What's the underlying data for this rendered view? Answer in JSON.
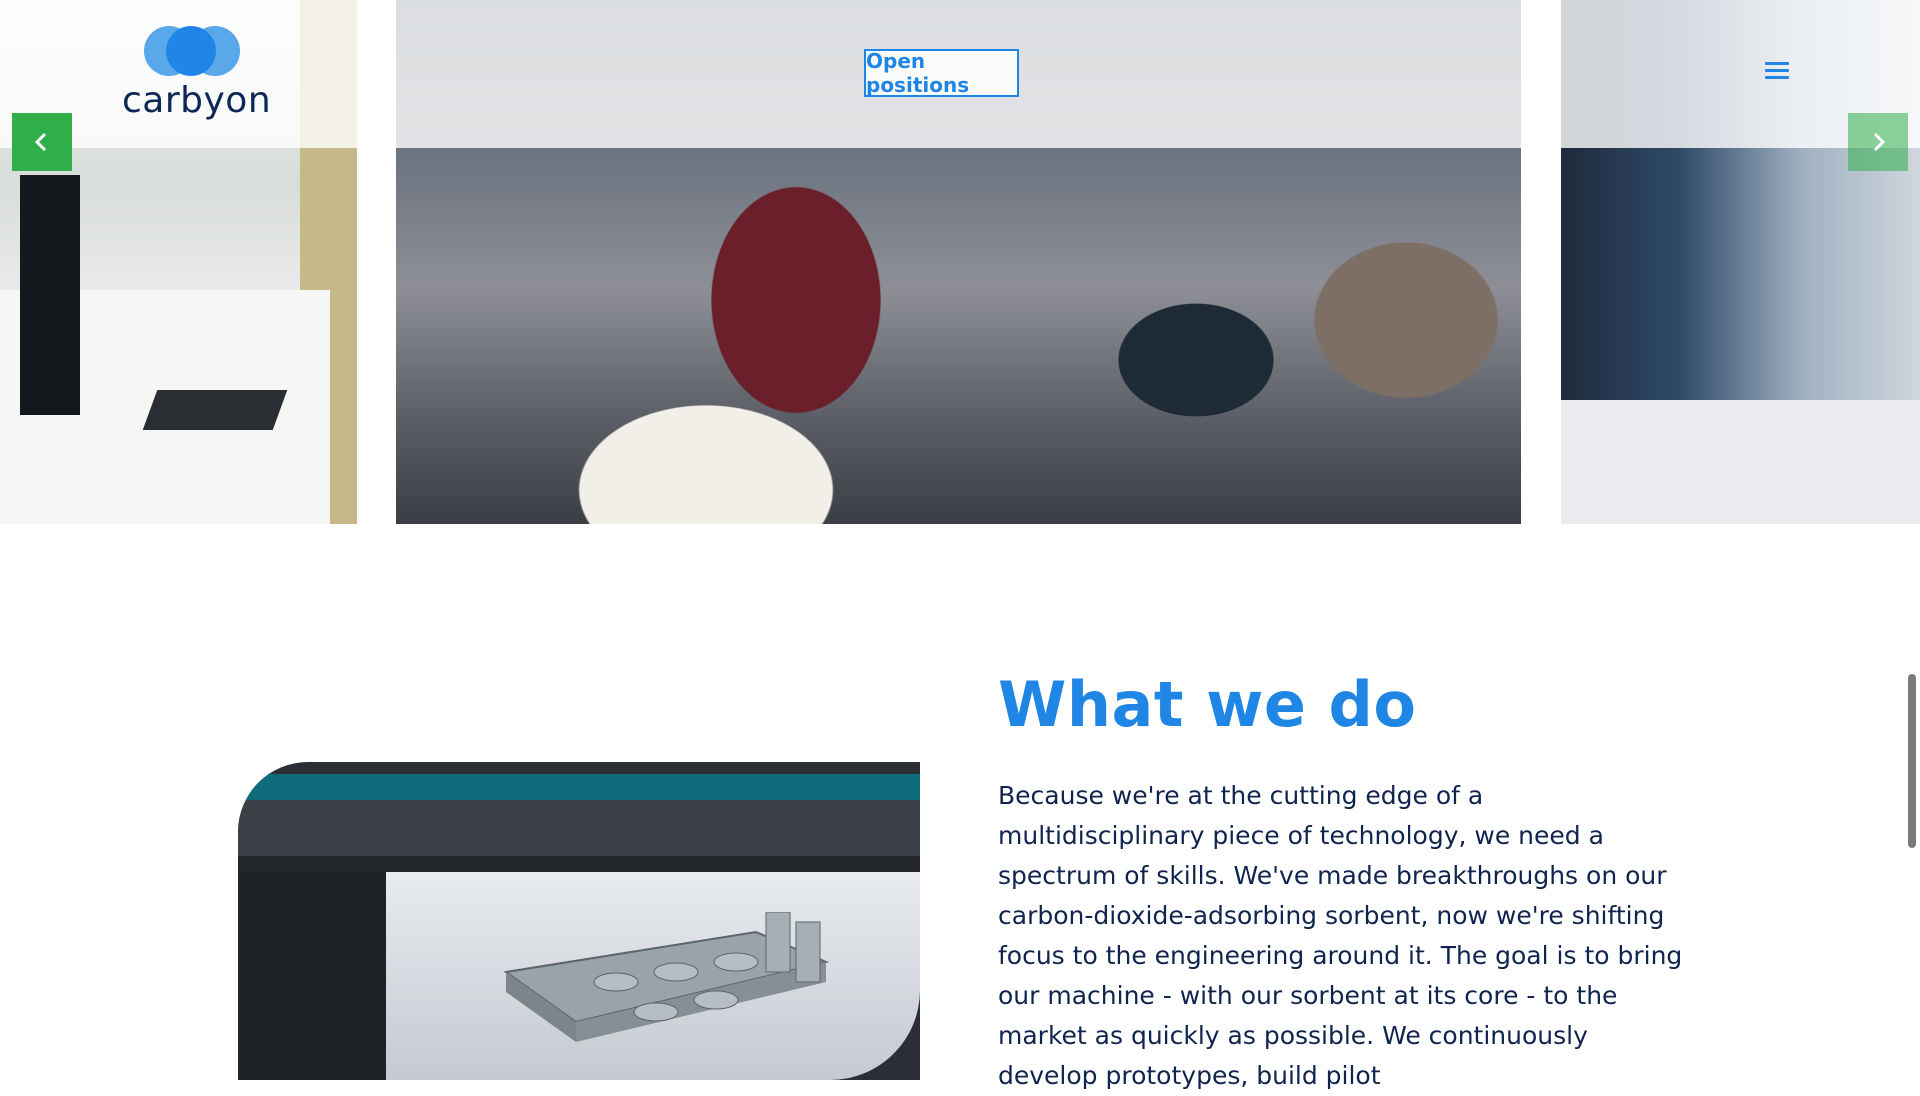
{
  "brand": {
    "name": "carbyon"
  },
  "header": {
    "cta_label": "Open positions",
    "menu_icon": "hamburger-menu-icon"
  },
  "carousel": {
    "prev_icon": "chevron-left-icon",
    "next_icon": "chevron-right-icon",
    "slides": [
      "office-desk-photo",
      "team-meeting-photo",
      "lab-equipment-photo"
    ]
  },
  "section": {
    "title": "What we do",
    "body": "Because we're at the cutting edge of a multidisciplinary piece of technology, we need a spectrum of skills. We've made breakthroughs on our carbon-dioxide-adsorbing sorbent, now we're shifting focus to the engineering around it. The goal is to bring our machine - with our sorbent at its core - to the market as quickly as possible. We continuously develop prototypes, build pilot"
  },
  "colors": {
    "accent": "#1f86e6",
    "logo_light": "#5aa8ea",
    "text_dark": "#10244f",
    "arrow_green": "#2fae4a"
  }
}
